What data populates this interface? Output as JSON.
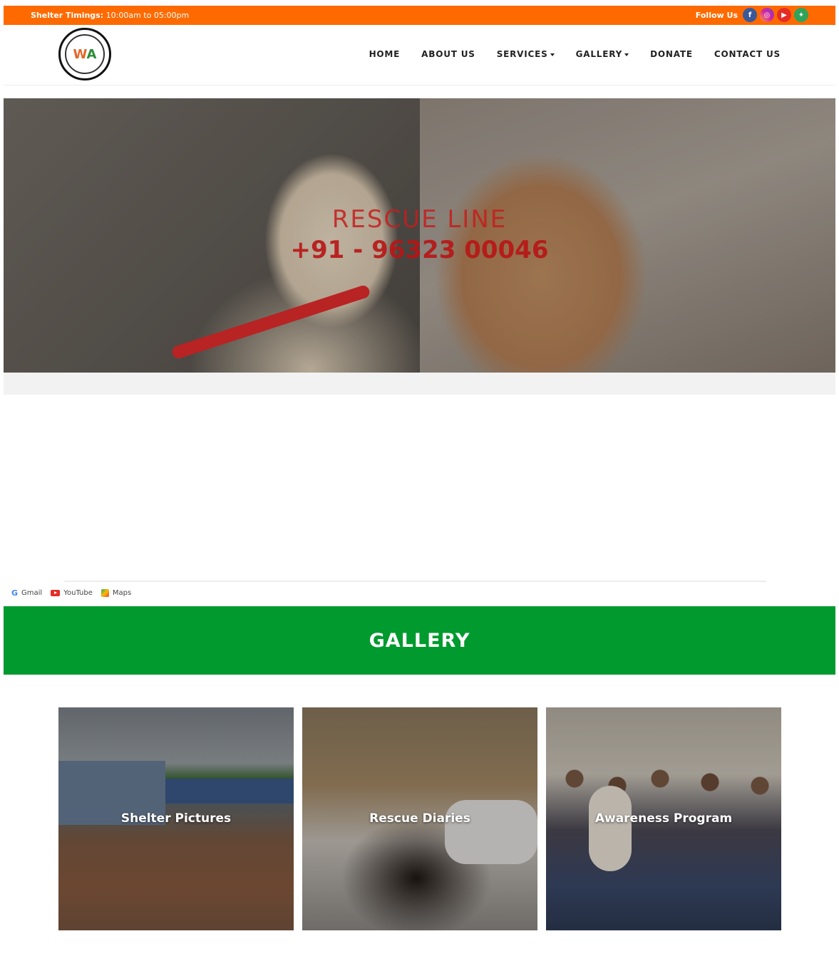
{
  "topbar": {
    "timing_label": "Shelter Timings:",
    "timing_value": " 10:00am to 05:00pm",
    "follow_label": "Follow Us",
    "social": [
      {
        "icon": "facebook-icon",
        "glyph": "f"
      },
      {
        "icon": "instagram-icon",
        "glyph": "◎"
      },
      {
        "icon": "youtube-icon",
        "glyph": "▶"
      },
      {
        "icon": "maps-icon",
        "glyph": "✦"
      }
    ]
  },
  "header": {
    "logo_mark": "W",
    "logo_mark_accent": "A",
    "nav": {
      "home": "HOME",
      "about": "ABOUT US",
      "services": "SERVICES",
      "gallery": "GALLERY",
      "donate": "DONATE",
      "contact": "CONTACT US"
    }
  },
  "hero": {
    "title": "RESCUE LINE",
    "phone": "+91 - 96323 00046"
  },
  "bookmarks": {
    "gmail": "Gmail",
    "youtube": "YouTube",
    "maps": "Maps",
    "gmail_icon": "G"
  },
  "gallery": {
    "title": "GALLERY",
    "cards": [
      {
        "label": "Shelter Pictures"
      },
      {
        "label": "Rescue Diaries"
      },
      {
        "label": "Awareness Program"
      }
    ]
  },
  "colors": {
    "topbar": "#ff6a00",
    "gallery_band": "#009a2e",
    "hero_text": "#c41e1e"
  }
}
